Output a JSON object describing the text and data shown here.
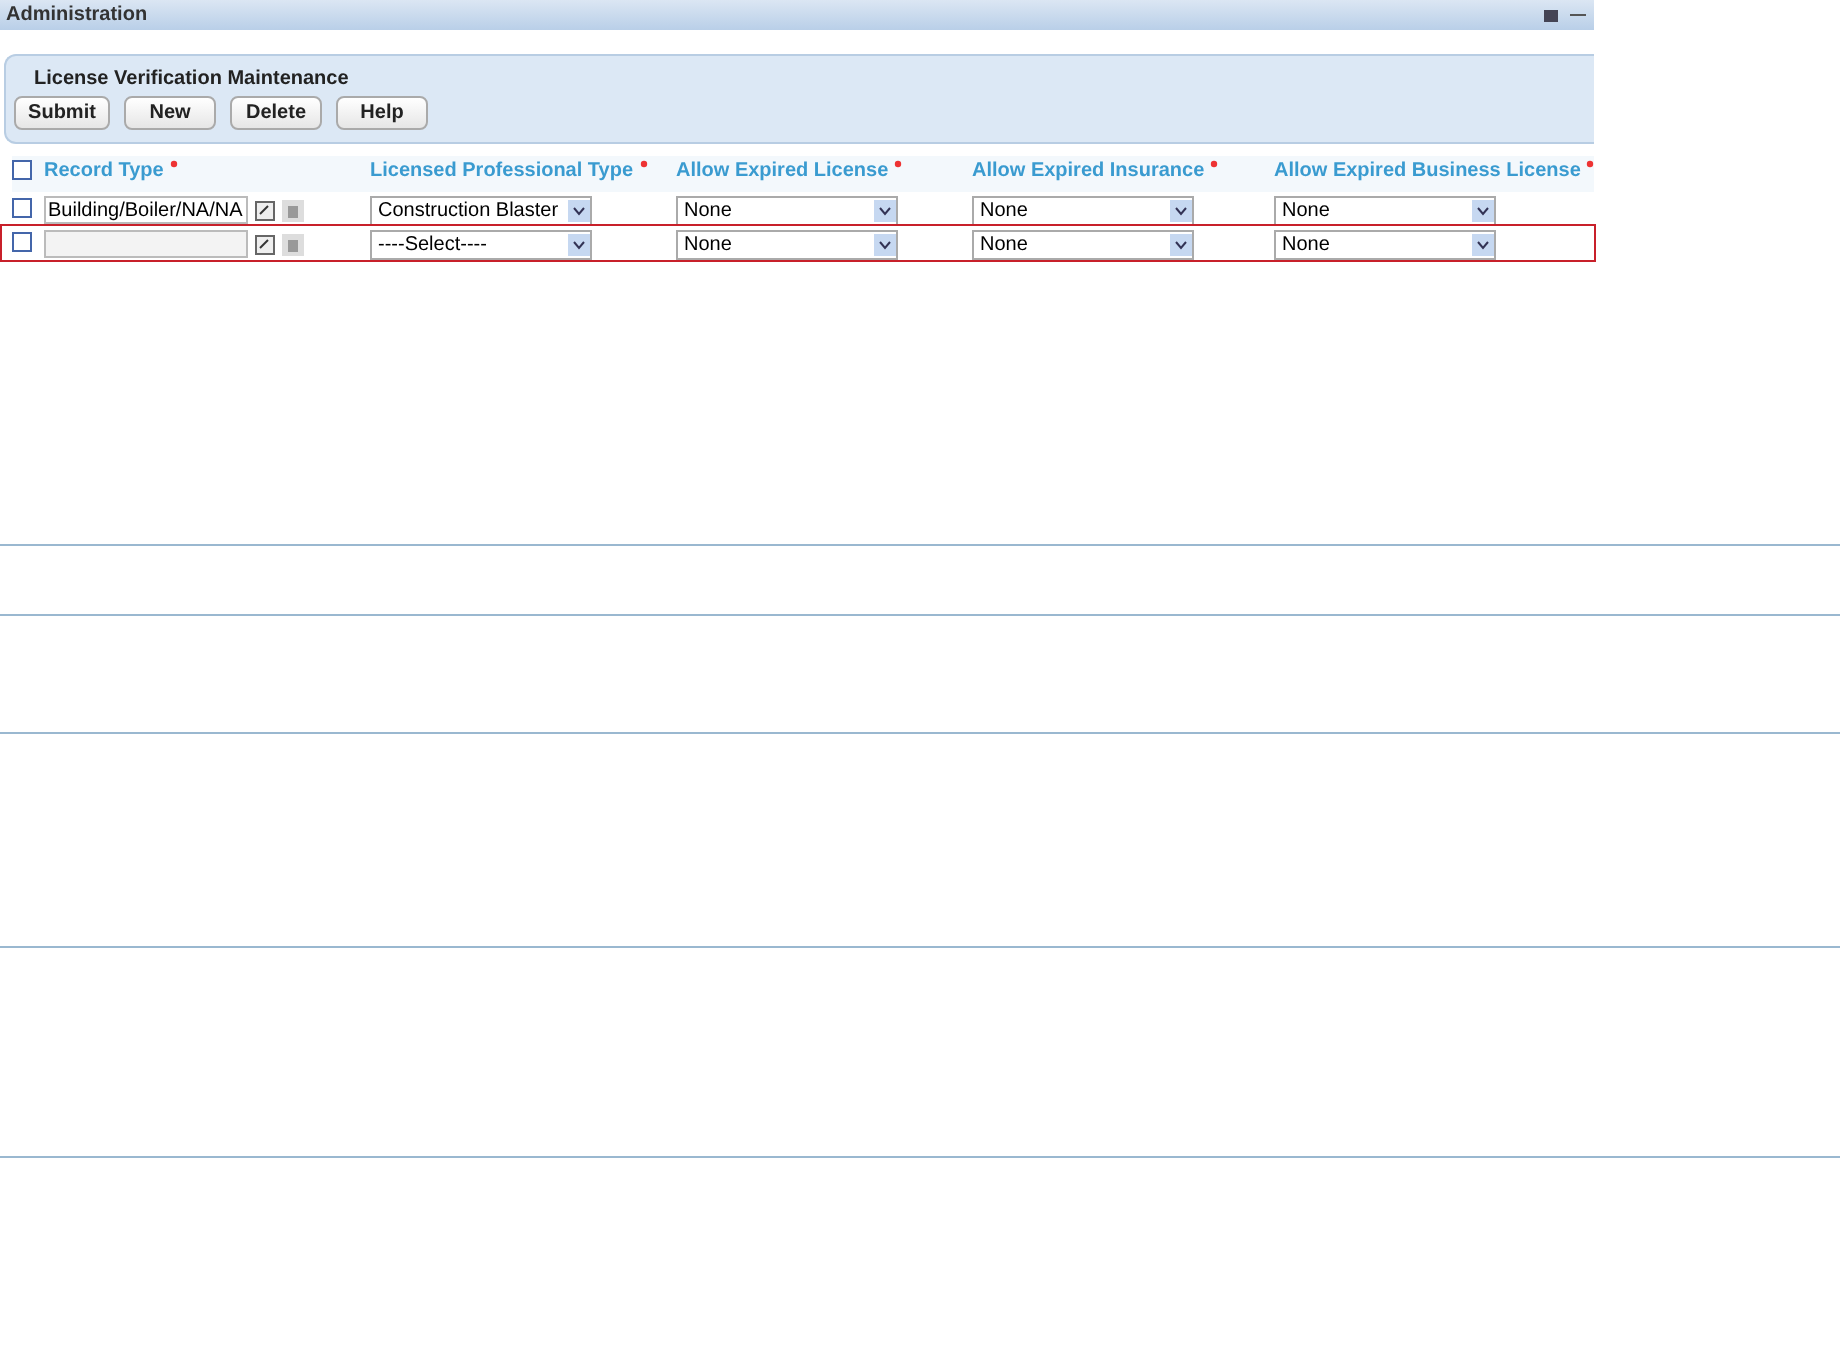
{
  "portlet": {
    "title": "Administration"
  },
  "form": {
    "title": "License Verification Maintenance",
    "buttons": [
      "Submit",
      "New",
      "Delete",
      "Help"
    ]
  },
  "table": {
    "select_all_checked": false,
    "columns": [
      {
        "label": "Record Type",
        "required": true
      },
      {
        "label": "Licensed Professional Type",
        "required": true
      },
      {
        "label": "Allow Expired License",
        "required": true
      },
      {
        "label": "Allow Expired Insurance",
        "required": true
      },
      {
        "label": "Allow Expired Business License",
        "required": true
      }
    ],
    "rows": [
      {
        "checked": false,
        "selected": false,
        "record_type": "Building/Boiler/NA/NA",
        "professional_type": "Construction Blaster",
        "expired_license": "None",
        "expired_insurance": "None",
        "expired_business_license": "None"
      },
      {
        "checked": false,
        "selected": true,
        "record_type": "",
        "professional_type": "----Select----",
        "expired_license": "None",
        "expired_insurance": "None",
        "expired_business_license": "None"
      }
    ]
  }
}
